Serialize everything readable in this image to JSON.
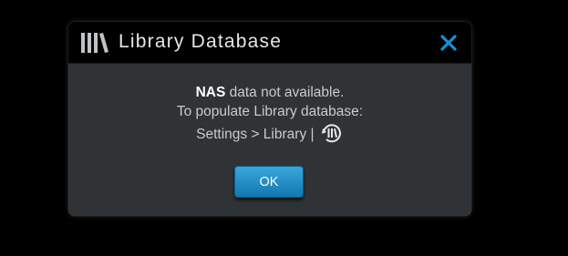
{
  "dialog": {
    "title": "Library Database",
    "title_icon": "library-books-icon",
    "close_icon": "close-icon",
    "message": {
      "bold": "NAS",
      "line1_rest": " data not available.",
      "line2": "To populate Library database:",
      "line3": "Settings > Library |",
      "line3_icon": "library-sync-icon"
    },
    "ok_label": "OK"
  },
  "colors": {
    "background": "#000000",
    "dialog_body": "#2f3335",
    "titlebar": "#000000",
    "accent": "#1a8fd0",
    "text": "#c9cbcc"
  }
}
